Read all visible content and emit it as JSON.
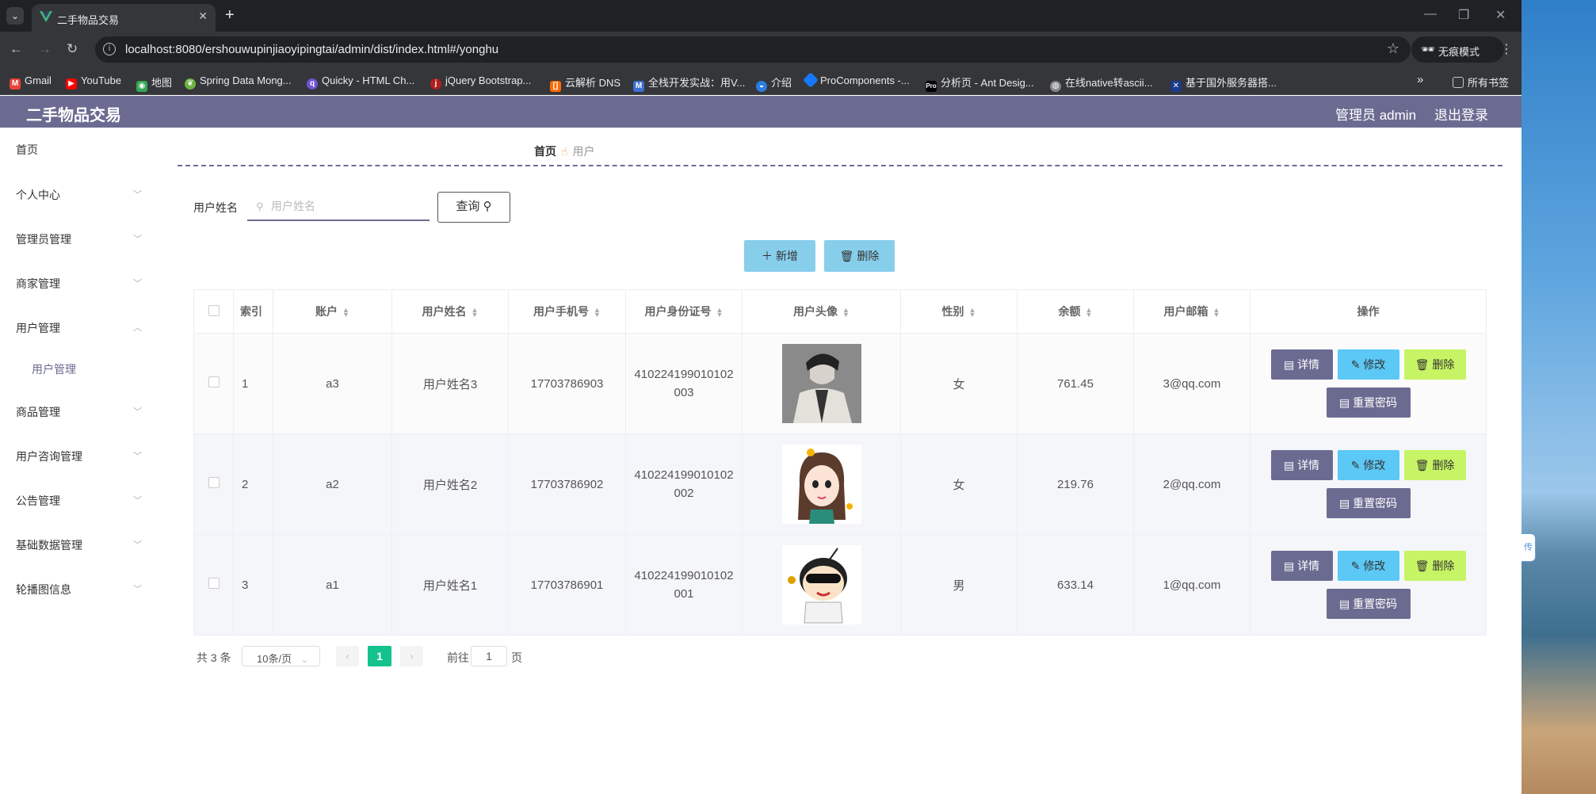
{
  "browser": {
    "tab_title": "二手物品交易",
    "url": "localhost:8080/ershouwupinjiaoyipingtai/admin/dist/index.html#/yonghu",
    "incognito_label": "无痕模式",
    "bookmarks": [
      {
        "label": "Gmail",
        "icon": "gmail-icon"
      },
      {
        "label": "YouTube",
        "icon": "youtube-icon"
      },
      {
        "label": "地图",
        "icon": "maps-icon"
      },
      {
        "label": "Spring Data Mong...",
        "icon": "spring-icon"
      },
      {
        "label": "Quicky - HTML Ch...",
        "icon": "quicky-icon"
      },
      {
        "label": "jQuery Bootstrap...",
        "icon": "jquery-icon"
      },
      {
        "label": "云解析 DNS",
        "icon": "aliyun-icon"
      },
      {
        "label": "全栈开发实战：用V...",
        "icon": "m-icon"
      },
      {
        "label": "介绍",
        "icon": "globe-icon"
      },
      {
        "label": "ProComponents -...",
        "icon": "procomponents-icon"
      },
      {
        "label": "分析页 - Ant Desig...",
        "icon": "pro-icon"
      },
      {
        "label": "在线native转ascii...",
        "icon": "globe-icon"
      },
      {
        "label": "基于国外服务器搭...",
        "icon": "flag-icon"
      }
    ],
    "all_bookmarks_label": "所有书签"
  },
  "header": {
    "app_title": "二手物品交易",
    "admin_label": "管理员 admin",
    "logout_label": "退出登录"
  },
  "sidebar": {
    "items": [
      {
        "label": "首页",
        "has_arrow": false
      },
      {
        "label": "个人中心",
        "has_arrow": true
      },
      {
        "label": "管理员管理",
        "has_arrow": true
      },
      {
        "label": "商家管理",
        "has_arrow": true
      },
      {
        "label": "用户管理",
        "has_arrow": true,
        "expanded": true
      },
      {
        "label": "商品管理",
        "has_arrow": true
      },
      {
        "label": "用户咨询管理",
        "has_arrow": true
      },
      {
        "label": "公告管理",
        "has_arrow": true
      },
      {
        "label": "基础数据管理",
        "has_arrow": true
      },
      {
        "label": "轮播图信息",
        "has_arrow": true
      }
    ],
    "sub_item": "用户管理"
  },
  "breadcrumb": {
    "home": "首页",
    "current": "用户"
  },
  "search": {
    "label": "用户姓名",
    "placeholder": "用户姓名",
    "value": "",
    "query_label": "查询"
  },
  "actions": {
    "add_label": "新增",
    "delete_label": "删除"
  },
  "table": {
    "columns": [
      "索引",
      "账户",
      "用户姓名",
      "用户手机号",
      "用户身份证号",
      "用户头像",
      "性别",
      "余额",
      "用户邮箱",
      "操作"
    ],
    "rows": [
      {
        "index": "1",
        "account": "a3",
        "name": "用户姓名3",
        "phone": "17703786903",
        "id_card_1": "410224199010102",
        "id_card_2": "003",
        "gender": "女",
        "balance": "761.45",
        "email": "3@qq.com"
      },
      {
        "index": "2",
        "account": "a2",
        "name": "用户姓名2",
        "phone": "17703786902",
        "id_card_1": "410224199010102",
        "id_card_2": "002",
        "gender": "女",
        "balance": "219.76",
        "email": "2@qq.com"
      },
      {
        "index": "3",
        "account": "a1",
        "name": "用户姓名1",
        "phone": "17703786901",
        "id_card_1": "410224199010102",
        "id_card_2": "001",
        "gender": "男",
        "balance": "633.14",
        "email": "1@qq.com"
      }
    ],
    "op_labels": {
      "detail": "详情",
      "edit": "修改",
      "delete": "删除",
      "reset": "重置密码"
    }
  },
  "pagination": {
    "total": "共 3 条",
    "page_size": "10条/页",
    "current_page": "1",
    "goto_label": "前往",
    "goto_value": "1",
    "page_suffix": "页"
  },
  "colors": {
    "primary": "#6b6b92",
    "sky": "#87ceeb",
    "edit": "#5bc8f5",
    "delete": "#c7f464",
    "page_active": "#13c28f"
  },
  "side_widget": {
    "label": "传"
  }
}
